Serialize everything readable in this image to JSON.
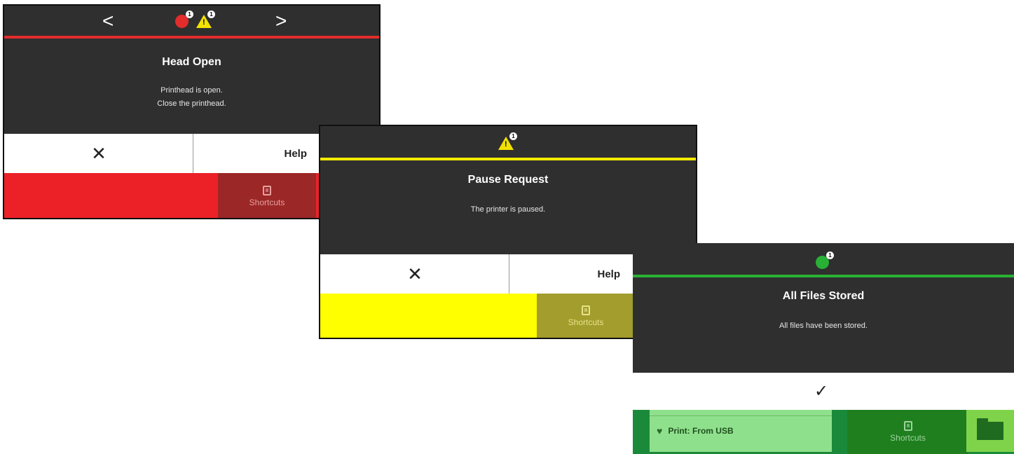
{
  "screens": [
    {
      "name": "head-open",
      "accent_color": "#e32c2c",
      "nav_prev": "<",
      "nav_next": ">",
      "error_badge": "1",
      "warning_badge": "1",
      "title": "Head Open",
      "message_line1": "Printhead is open.",
      "message_line2": "Close the printhead.",
      "close_label": "✕",
      "help_label": "Help",
      "shortcuts_label": "Shortcuts",
      "action_bar_color": "#ec2127",
      "shortcuts_color": "#9b2727"
    },
    {
      "name": "pause-request",
      "accent_color": "#f5ea00",
      "warning_badge": "1",
      "title": "Pause Request",
      "message_line1": "The printer is paused.",
      "close_label": "✕",
      "help_label": "Help",
      "shortcuts_label": "Shortcuts",
      "action_bar_color": "#ffff00",
      "shortcuts_color": "#a29d2c"
    },
    {
      "name": "all-files-stored",
      "accent_color": "#29b036",
      "info_badge": "1",
      "title": "All Files Stored",
      "message_line1": "All files have been stored.",
      "confirm_label": "✓",
      "print_usb_label": "Print: From USB",
      "shortcuts_label": "Shortcuts",
      "action_bar_color": "#1a8a3a",
      "shortcuts_color": "#1f7f1f"
    }
  ]
}
